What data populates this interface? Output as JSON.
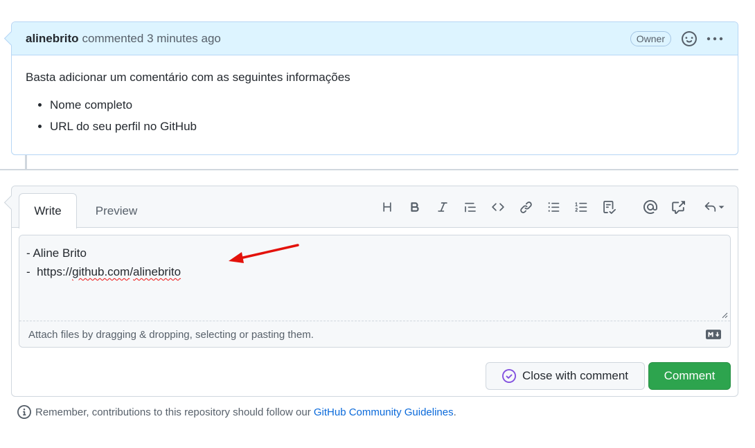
{
  "comment": {
    "author": "alinebrito",
    "action": "commented",
    "time": "3 minutes ago",
    "badge": "Owner",
    "body_intro": "Basta adicionar um comentário com as seguintes informações",
    "list_items": [
      "Nome completo",
      "URL do seu perfil no GitHub"
    ],
    "icons": {
      "reaction": "smiley-icon",
      "menu": "kebab-horizontal-icon"
    }
  },
  "editor": {
    "tabs": {
      "write": "Write",
      "preview": "Preview",
      "active": "Write"
    },
    "toolbar": [
      "heading-icon",
      "bold-icon",
      "italic-icon",
      "quote-icon",
      "code-icon",
      "link-icon",
      "unordered-list-icon",
      "ordered-list-icon",
      "task-list-icon",
      "mention-icon",
      "cross-reference-icon",
      "saved-replies-icon"
    ],
    "text_lines": [
      "- Aline Brito",
      "-  https://",
      "github.com",
      "/",
      "alinebrito"
    ],
    "attach_text": "Attach files by dragging & dropping, selecting or pasting them.",
    "close_label": "Close with comment",
    "comment_label": "Comment"
  },
  "footer": {
    "text": "Remember, contributions to this repository should follow our",
    "link": "GitHub Community Guidelines",
    "suffix": "."
  },
  "colors": {
    "header_bg": "#ddf4ff",
    "primary_button": "#2da44e",
    "link": "#0969da",
    "close_icon": "#8250df",
    "annotation": "#e3120b"
  }
}
